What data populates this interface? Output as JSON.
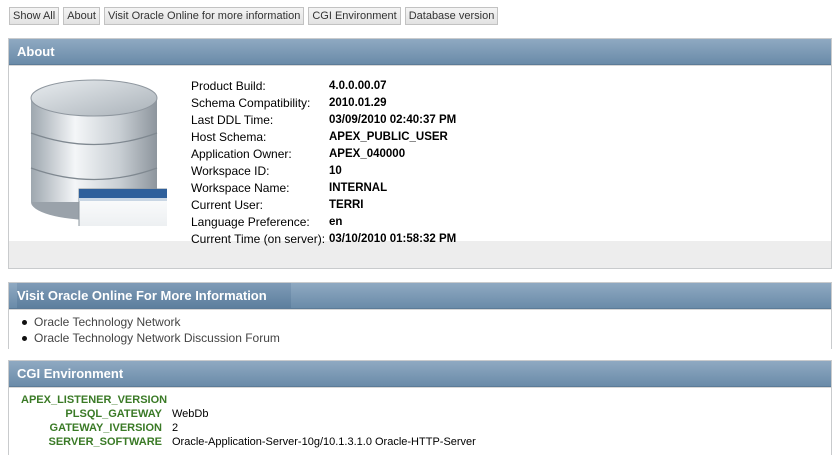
{
  "toolbar": {
    "buttons": [
      "Show All",
      "About",
      "Visit Oracle Online for more information",
      "CGI Environment",
      "Database version"
    ]
  },
  "about": {
    "title": "About",
    "rows": [
      {
        "label": "Product Build:",
        "value": "4.0.0.00.07"
      },
      {
        "label": "Schema Compatibility:",
        "value": "2010.01.29"
      },
      {
        "label": "Last DDL Time:",
        "value": "03/09/2010 02:40:37 PM"
      },
      {
        "label": "Host Schema:",
        "value": "APEX_PUBLIC_USER"
      },
      {
        "label": "Application Owner:",
        "value": "APEX_040000"
      },
      {
        "label": "Workspace ID:",
        "value": "10"
      },
      {
        "label": "Workspace Name:",
        "value": "INTERNAL"
      },
      {
        "label": "Current User:",
        "value": "TERRI"
      },
      {
        "label": "Language Preference:",
        "value": "en"
      },
      {
        "label": "Current Time (on server):",
        "value": "03/10/2010 01:58:32 PM"
      }
    ]
  },
  "visit": {
    "title": "Visit Oracle Online For More Information",
    "links": [
      "Oracle Technology Network",
      "Oracle Technology Network Discussion Forum"
    ]
  },
  "cgi": {
    "title": "CGI Environment",
    "rows": [
      {
        "key": "APEX_LISTENER_VERSION",
        "value": ""
      },
      {
        "key": "PLSQL_GATEWAY",
        "value": "WebDb"
      },
      {
        "key": "GATEWAY_IVERSION",
        "value": "2"
      },
      {
        "key": "SERVER_SOFTWARE",
        "value": "Oracle-Application-Server-10g/10.1.3.1.0 Oracle-HTTP-Server"
      }
    ]
  }
}
